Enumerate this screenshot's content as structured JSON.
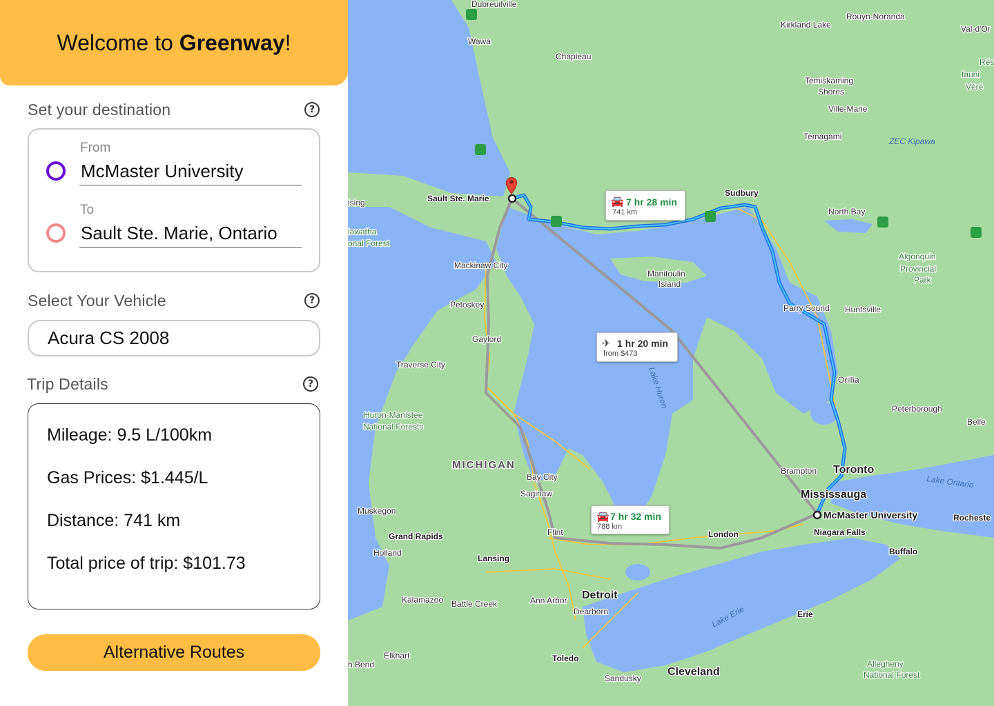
{
  "header": {
    "prefix": "Welcome to ",
    "brand": "Greenway",
    "suffix": "!"
  },
  "destination": {
    "label": "Set your destination",
    "help": "?",
    "from": {
      "label": "From",
      "value": "McMaster University",
      "dot_color": "#6A0DD6"
    },
    "to": {
      "label": "To",
      "value": "Sault Ste. Marie, Ontario",
      "dot_color": "#F58A8A"
    }
  },
  "vehicle": {
    "label": "Select Your Vehicle",
    "help": "?",
    "selected": "Acura CS 2008"
  },
  "trip": {
    "label": "Trip Details",
    "help": "?",
    "mileage": "Mileage: 9.5 L/100km",
    "gas": "Gas Prices: $1.445/L",
    "distance": "Distance: 741 km",
    "total": "Total price of trip: $101.73"
  },
  "alt_button": "Alternative Routes",
  "colors": {
    "accent": "#FFBD45",
    "route": "#1a73e8",
    "land": "#9fd39b",
    "water": "#8ab4f8"
  },
  "map": {
    "routes": [
      {
        "time": "7 hr 28 min",
        "sub": "741 km",
        "icon": "car-icon"
      },
      {
        "time": "1 hr 20 min",
        "sub": "from $473",
        "icon": "plane-icon"
      },
      {
        "time": "7 hr 32 min",
        "sub": "788 km",
        "icon": "car-icon"
      }
    ],
    "labels": {
      "dubreuillville": "Dubreuilville",
      "wawa": "Wawa",
      "chapleau": "Chapleau",
      "rouyn": "Rouyn-Noranda",
      "kirkland": "Kirkland Lake",
      "valdor": "Val-d'Or",
      "temiskaming": "Temiskaming",
      "shores": "Shores",
      "villemarie": "Ville-Marie",
      "temagami": "Temagami",
      "zec": "ZEC Kipawa",
      "sault": "Sault Ste. Marie",
      "sudbury": "Sudbury",
      "northbay": "North Bay",
      "mackinaw": "Mackinaw City",
      "manitoulin1": "Manitoulin",
      "manitoulin2": "Island",
      "algonquin1": "Algonquin",
      "algonquin2": "Provincial",
      "algonquin3": "Park",
      "petoskey": "Petoskey",
      "parrysound": "Parry Sound",
      "huntsville": "Huntsville",
      "gaylord": "Gaylord",
      "traverse": "Traverse City",
      "lakehuron": "Lake Huron",
      "orillia": "Orillia",
      "peterborough": "Peterborough",
      "huronmanistee1": "Huron-Manistee",
      "huronmanistee2": "National Forests",
      "michigan": "MICHIGAN",
      "baycity": "Bay City",
      "saginaw": "Saginaw",
      "brampton": "Brampton",
      "toronto": "Toronto",
      "mississauga": "Mississauga",
      "lakeontario": "Lake Ontario",
      "muskegon": "Muskegon",
      "mcmaster": "McMaster University",
      "rochester": "Rocheste",
      "grandrapids": "Grand Rapids",
      "flint": "Flint",
      "london": "London",
      "niagara": "Niagara Falls",
      "buffalo": "Buffalo",
      "holland": "Holland",
      "lansing": "Lansing",
      "detroit": "Detroit",
      "dearborn": "Dearborn",
      "annarbor": "Ann Arbor",
      "kalamazoo": "Kalamazoo",
      "battlecreek": "Battle Creek",
      "lakeerie": "Lake Erie",
      "erie": "Erie",
      "elkhart": "Elkhart",
      "toledo": "Toledo",
      "bend": "h Bend",
      "cleveland": "Cleveland",
      "sandusky": "Sandusky",
      "allegheny1": "Allegheny",
      "allegheny2": "National Forest",
      "hiawatha1": "iawatha",
      "hiawatha2": "onal Forest",
      "ising": "ising",
      "belle": "Belle",
      "res1": "Rés",
      "res2": "fauni",
      "res3": "Véré"
    }
  }
}
